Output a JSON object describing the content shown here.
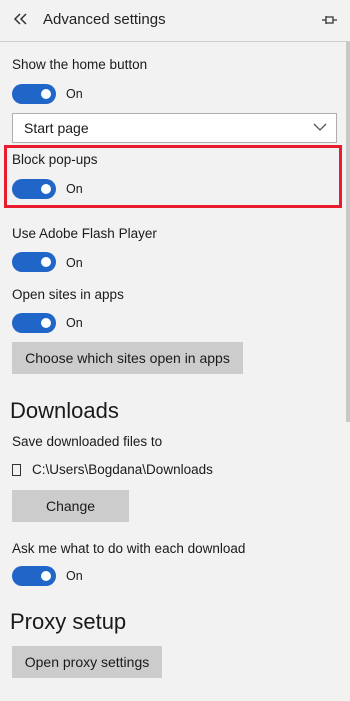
{
  "header": {
    "back_icon": "double-chevron-left-icon",
    "title": "Advanced settings",
    "pin_icon": "pin-icon"
  },
  "home_button": {
    "label": "Show the home button",
    "toggle_state": "On",
    "select_value": "Start page"
  },
  "popups": {
    "label": "Block pop-ups",
    "toggle_state": "On"
  },
  "flash": {
    "label": "Use Adobe Flash Player",
    "toggle_state": "On"
  },
  "open_in_apps": {
    "label": "Open sites in apps",
    "toggle_state": "On",
    "button": "Choose which sites open in apps"
  },
  "downloads": {
    "section_title": "Downloads",
    "save_label": "Save downloaded files to",
    "path": "C:\\Users\\Bogdana\\Downloads",
    "change_button": "Change",
    "ask_label": "Ask me what to do with each download",
    "ask_toggle_state": "On"
  },
  "proxy": {
    "section_title": "Proxy setup",
    "button": "Open proxy settings"
  },
  "colors": {
    "toggle_on": "#1f66c8",
    "highlight": "#e81c2c",
    "background": "#f2f2f2",
    "button_bg": "#cccccc"
  }
}
